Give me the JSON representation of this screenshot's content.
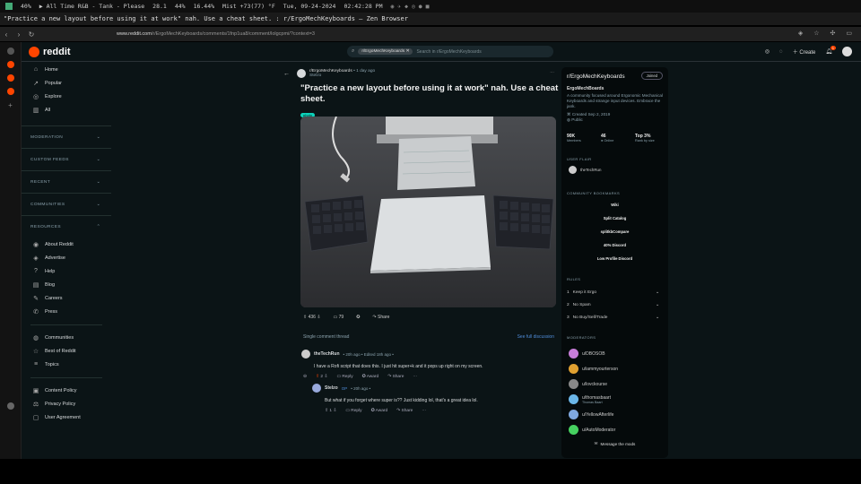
{
  "topbar": {
    "items": [
      "40%",
      "▶ All Time R&B - Tank - Please",
      "28.1",
      "44%",
      "16.44%",
      "Mist +73(77) °F",
      "Tue, 09-24-2024",
      "02:42:28 PM"
    ]
  },
  "window": {
    "title": "\"Practice a new layout before using it at work\" nah. Use a cheat sheet. : r/ErgoMechKeyboards — Zen Browser"
  },
  "browser": {
    "url_host": "www.reddit.com",
    "url_path": "/r/ErgoMechKeyboards/comments/1fnp1ua8/comment/lolgcpmi/?context=3"
  },
  "reddit": {
    "logo_text": "reddit",
    "search": {
      "chip": "r/ErgoMechKeyboards",
      "placeholder": "Search in r/ErgoMechKeyboards"
    },
    "create_label": "Create",
    "notif_count": "1"
  },
  "left_nav": {
    "primary": [
      {
        "label": "Home",
        "icon": "home-icon",
        "glyph": "⌂"
      },
      {
        "label": "Popular",
        "icon": "popular-icon",
        "glyph": "↗"
      },
      {
        "label": "Explore",
        "icon": "explore-icon",
        "glyph": "◎"
      },
      {
        "label": "All",
        "icon": "all-icon",
        "glyph": "▥"
      }
    ],
    "sections": [
      "MODERATION",
      "CUSTOM FEEDS",
      "RECENT",
      "COMMUNITIES",
      "RESOURCES"
    ],
    "resources": [
      {
        "label": "About Reddit",
        "glyph": "◉"
      },
      {
        "label": "Advertise",
        "glyph": "◈"
      },
      {
        "label": "Help",
        "glyph": "?"
      },
      {
        "label": "Blog",
        "glyph": "▤"
      },
      {
        "label": "Careers",
        "glyph": "✎"
      },
      {
        "label": "Press",
        "glyph": "✆"
      }
    ],
    "extras": [
      {
        "label": "Communities",
        "glyph": "◍"
      },
      {
        "label": "Best of Reddit",
        "glyph": "☆"
      },
      {
        "label": "Topics",
        "glyph": "≡"
      }
    ],
    "policies": [
      {
        "label": "Content Policy",
        "glyph": "▣"
      },
      {
        "label": "Privacy Policy",
        "glyph": "⚖"
      },
      {
        "label": "User Agreement",
        "glyph": "▢"
      }
    ]
  },
  "post": {
    "subreddit": "r/ErgoMechKeyboards",
    "age": "• 1 day ago",
    "author": "Stelzo",
    "title": "\"Practice a new layout before using it at work\" nah. Use a cheat sheet.",
    "flair": "photo",
    "votes": "436",
    "comments": "79",
    "share_label": "Share",
    "thread_label": "Single comment thread",
    "see_full": "See full discussion"
  },
  "comments": [
    {
      "author": "theTechRun",
      "meta": "• 20h ago • Edited 18h ago •",
      "text": "I have a Rofi script that does this. I just hit super+k and it pops up right on my screen.",
      "votes": "2",
      "reply": "Reply",
      "award": "Award",
      "share": "Share"
    },
    {
      "author": "Stelzo",
      "op": "OP",
      "meta": "• 20h ago •",
      "text": "But what if you forget where super is?? Just kidding lol, that's a great idea lol.",
      "votes": "1",
      "reply": "Reply",
      "award": "Award",
      "share": "Share"
    }
  ],
  "sidebar": {
    "name": "r/ErgoMechKeyboards",
    "joined": "Joined",
    "heading": "ErgoMechBoards",
    "description": "A community focused around Ergonomic Mechanical Keyboards and strange input devices. Embrace the jank.",
    "created": "Created Sep 2, 2019",
    "visibility": "Public",
    "stats": [
      {
        "value": "90K",
        "label": "Members"
      },
      {
        "value": "46",
        "label": "● Online"
      },
      {
        "value": "Top 3%",
        "label": "Rank by size"
      }
    ],
    "user_flair_label": "USER FLAIR",
    "user_flair_name": "theTechRun",
    "bookmarks_label": "COMMUNITY BOOKMARKS",
    "bookmarks": [
      "Wiki",
      "Split Catalog",
      "splitkbCompare",
      "40% Discord",
      "Low Profile Discord"
    ],
    "rules_label": "RULES",
    "rules": [
      {
        "num": "1",
        "text": "Keep it Ergo"
      },
      {
        "num": "2",
        "text": "No Spam"
      },
      {
        "num": "3",
        "text": "No Buy/Sell/Trade"
      }
    ],
    "moderators_label": "MODERATORS",
    "moderators": [
      {
        "name": "u/DBOSOB",
        "sub": "",
        "color": "#c77dd8"
      },
      {
        "name": "u/iammyourterson",
        "sub": "",
        "color": "#e0a030"
      },
      {
        "name": "u/lovckourse",
        "sub": "",
        "color": "#888"
      },
      {
        "name": "u/thomasbaart",
        "sub": "Thomas Baart",
        "color": "#6bb6e8"
      },
      {
        "name": "u/YellowAfterlife",
        "sub": "",
        "color": "#7fa8e0"
      },
      {
        "name": "u/AutoModerator",
        "sub": "",
        "color": "#46d160"
      }
    ],
    "message_mods": "Message the mods"
  }
}
